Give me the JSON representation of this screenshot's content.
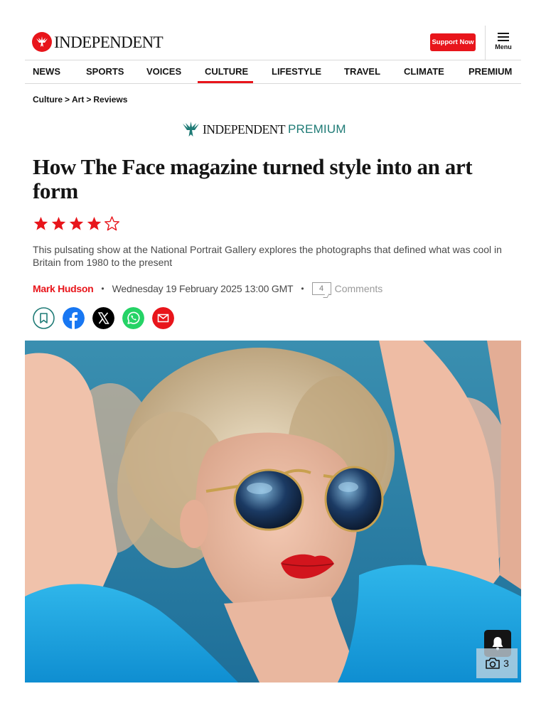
{
  "header": {
    "logo_text": "INDEPENDENT",
    "support_label": "Support Now",
    "menu_label": "Menu"
  },
  "nav": {
    "items": [
      "NEWS",
      "SPORTS",
      "VOICES",
      "CULTURE",
      "LIFESTYLE",
      "TRAVEL",
      "CLIMATE",
      "PREMIUM"
    ],
    "active": "CULTURE"
  },
  "breadcrumb": {
    "items": [
      "Culture",
      "Art",
      "Reviews"
    ],
    "separator": ">"
  },
  "premium": {
    "brand": "INDEPENDENT",
    "label": "PREMIUM"
  },
  "article": {
    "headline": "How The Face magazine turned style into an art form",
    "rating": {
      "value": 4,
      "max": 5
    },
    "standfirst": "This pulsating show at the National Portrait Gallery explores the photographs that defined what was cool in Britain from 1980 to the present",
    "author": "Mark Hudson",
    "date": "Wednesday 19 February 2025 13:00 GMT",
    "comments_count": "4",
    "comments_label": "Comments"
  },
  "share": [
    "bookmark-icon",
    "facebook-icon",
    "x-icon",
    "whatsapp-icon",
    "email-icon"
  ],
  "gallery": {
    "count": "3"
  },
  "colors": {
    "brand_red": "#e8151b",
    "premium_teal": "#1f7b76",
    "facebook_blue": "#1877f2",
    "whatsapp_green": "#25d366",
    "text": "#141414"
  }
}
